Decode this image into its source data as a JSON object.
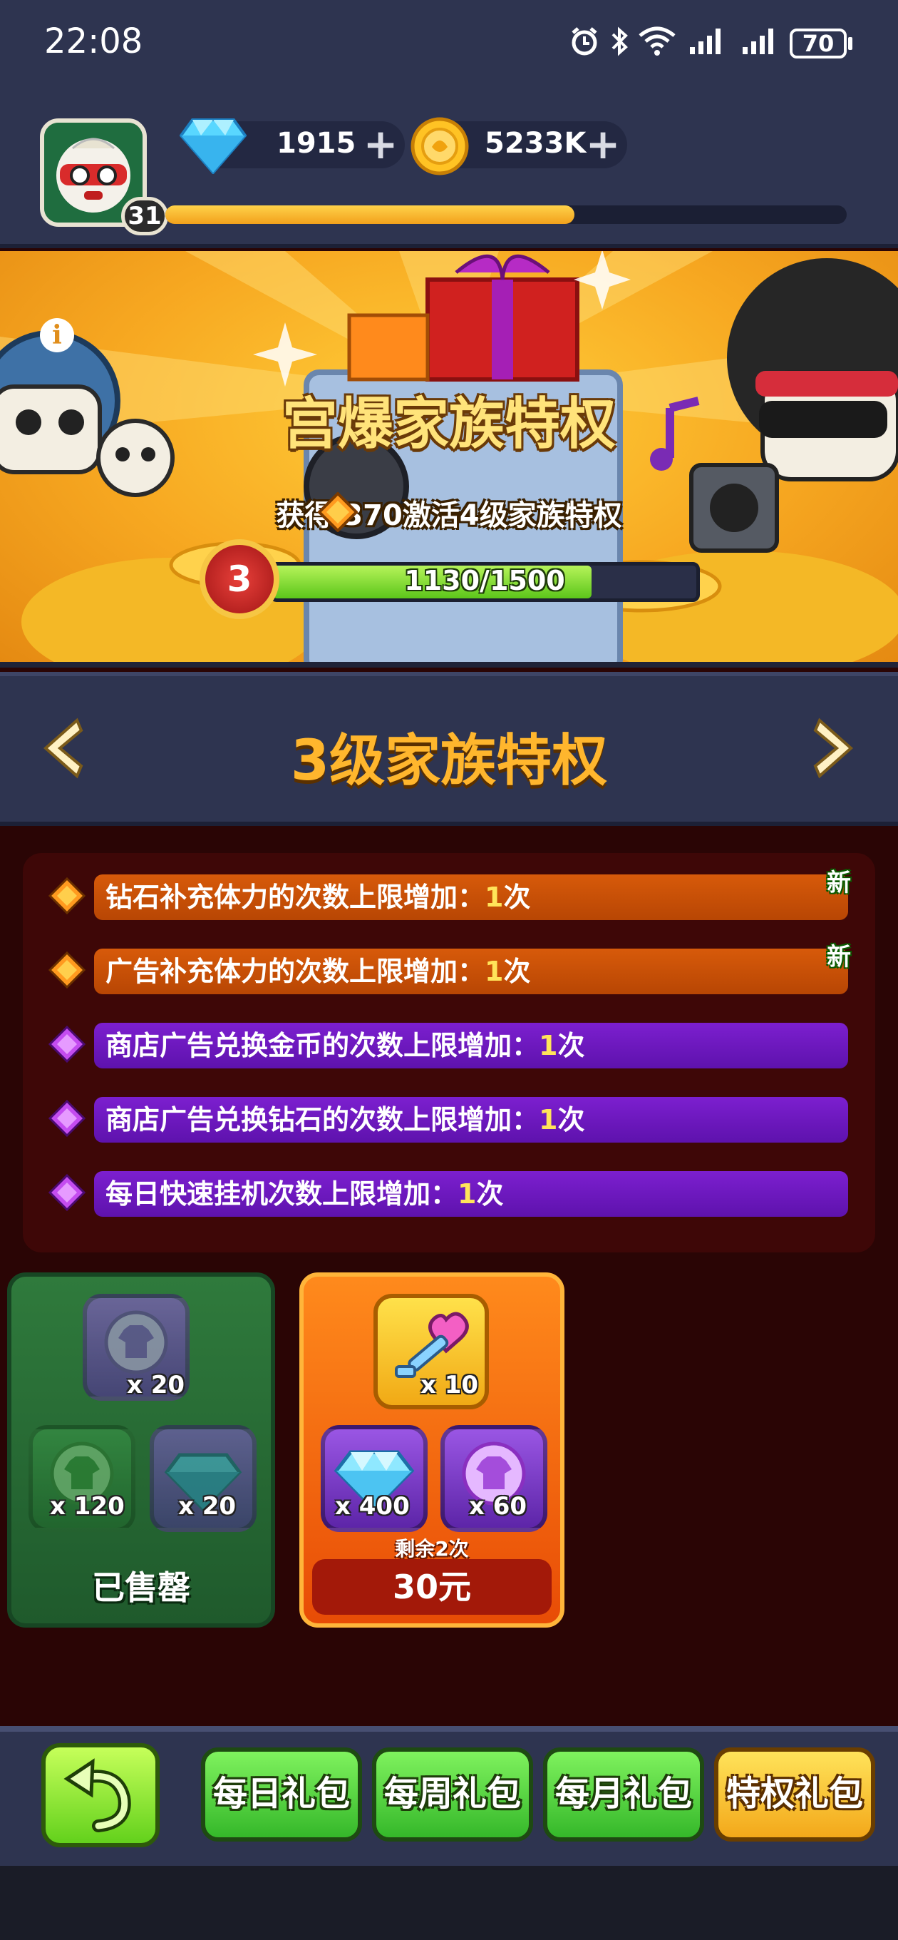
{
  "status_bar": {
    "time": "22:08",
    "battery": "70",
    "icons": [
      "alarm-icon",
      "bluetooth-icon",
      "wifi-icon",
      "signal-icon",
      "signal-icon"
    ]
  },
  "header": {
    "player_level": "31",
    "xp_progress": 0.6,
    "diamonds": "1915",
    "gold": "5233K"
  },
  "banner": {
    "title": "宫爆家族特权",
    "subtitle": "获得 370激活4级家族特权",
    "current_level": "3",
    "progress_text": "1130/1500",
    "progress_value": 1130,
    "progress_max": 1500
  },
  "tier": {
    "title": "3级家族特权"
  },
  "perks": [
    {
      "text": "钻石补充体力的次数上限增加：",
      "num": "1",
      "unit": "次",
      "color": "orange",
      "is_new": true
    },
    {
      "text": "广告补充体力的次数上限增加：",
      "num": "1",
      "unit": "次",
      "color": "orange",
      "is_new": true
    },
    {
      "text": "商店广告兑换金币的次数上限增加：",
      "num": "1",
      "unit": "次",
      "color": "purple",
      "is_new": false
    },
    {
      "text": "商店广告兑换钻石的次数上限增加：",
      "num": "1",
      "unit": "次",
      "color": "purple",
      "is_new": false
    },
    {
      "text": "每日快速挂机次数上限增加：",
      "num": "1",
      "unit": "次",
      "color": "purple",
      "is_new": false
    }
  ],
  "new_label": "新",
  "cards": {
    "green": {
      "items": [
        {
          "icon": "purple-shirt-icon",
          "qty": "x 20"
        },
        {
          "icon": "green-shirt-icon",
          "qty": "x 120"
        },
        {
          "icon": "blue-diamond-icon",
          "qty": "x 20"
        }
      ],
      "status": "已售罄"
    },
    "orange": {
      "items": [
        {
          "icon": "heart-key-icon",
          "qty": "x 10"
        },
        {
          "icon": "diamond-icon",
          "qty": "x 400"
        },
        {
          "icon": "purple-shirt-icon",
          "qty": "x 60"
        }
      ],
      "remaining": "剩余2次",
      "price": "30元"
    }
  },
  "bottom_nav": {
    "daily": "每日礼包",
    "weekly": "每周礼包",
    "monthly": "每月礼包",
    "privilege": "特权礼包"
  },
  "colors": {
    "accent_gold": "#ffb62d",
    "orange_bar": "#c84f06",
    "purple_bar": "#6c18bf",
    "header_bg": "#2e3450"
  }
}
